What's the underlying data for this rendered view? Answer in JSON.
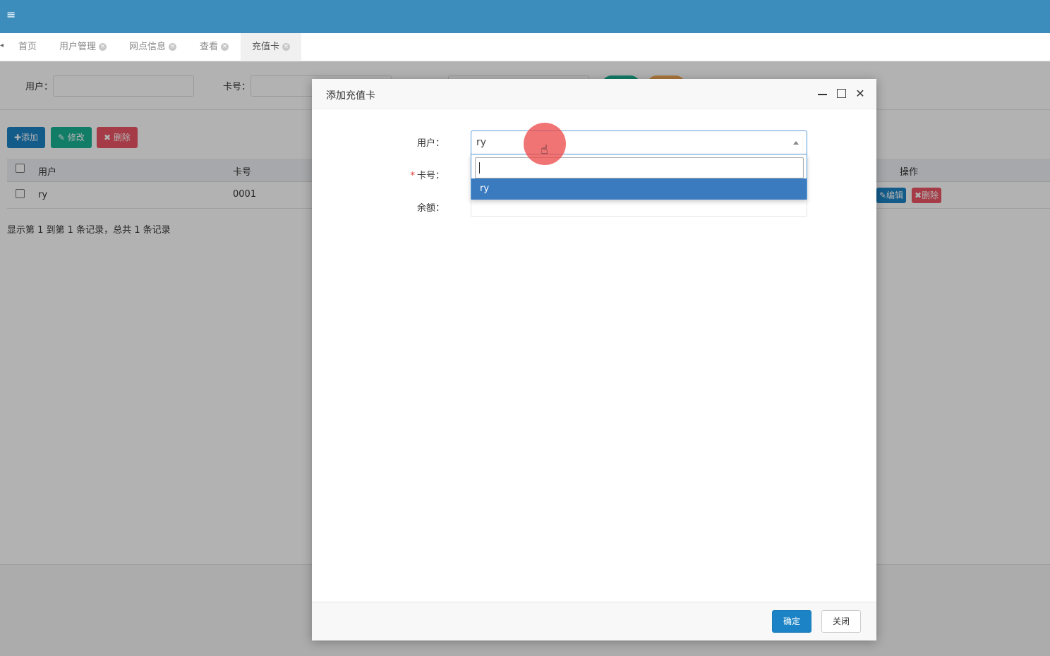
{
  "header": {
    "menu_icon": "hamburger-icon",
    "color": "#3c8dbc"
  },
  "tabs": [
    {
      "label": "首页",
      "closable": false
    },
    {
      "label": "用户管理",
      "closable": true
    },
    {
      "label": "网点信息",
      "closable": true
    },
    {
      "label": "查看",
      "closable": true
    },
    {
      "label": "充值卡",
      "closable": true,
      "active": true
    }
  ],
  "search": {
    "user_label": "用户：",
    "card_label": "卡号："
  },
  "toolbar": {
    "add_label": "✚添加",
    "edit_label": "✎ 修改",
    "delete_label": "✖ 删除"
  },
  "table": {
    "columns": [
      "用户",
      "卡号",
      "操作"
    ],
    "rows": [
      {
        "user": "ry",
        "card": "0001",
        "edit_label": "✎编辑",
        "delete_label": "✖删除"
      }
    ],
    "pager_info": "显示第 1 到第 1 条记录，总共 1 条记录"
  },
  "modal": {
    "title": "添加充值卡",
    "user_label": "用户：",
    "card_label": "卡号：",
    "balance_label": "余额：",
    "required_mark": "*",
    "selected_user": "ry",
    "search_value": "",
    "options": [
      "ry"
    ],
    "ok_label": "确定",
    "close_label": "关闭"
  },
  "colors": {
    "primary": "#1c84c6",
    "danger": "#ed5565",
    "success": "#1ab394",
    "warning": "#f8ac59"
  }
}
